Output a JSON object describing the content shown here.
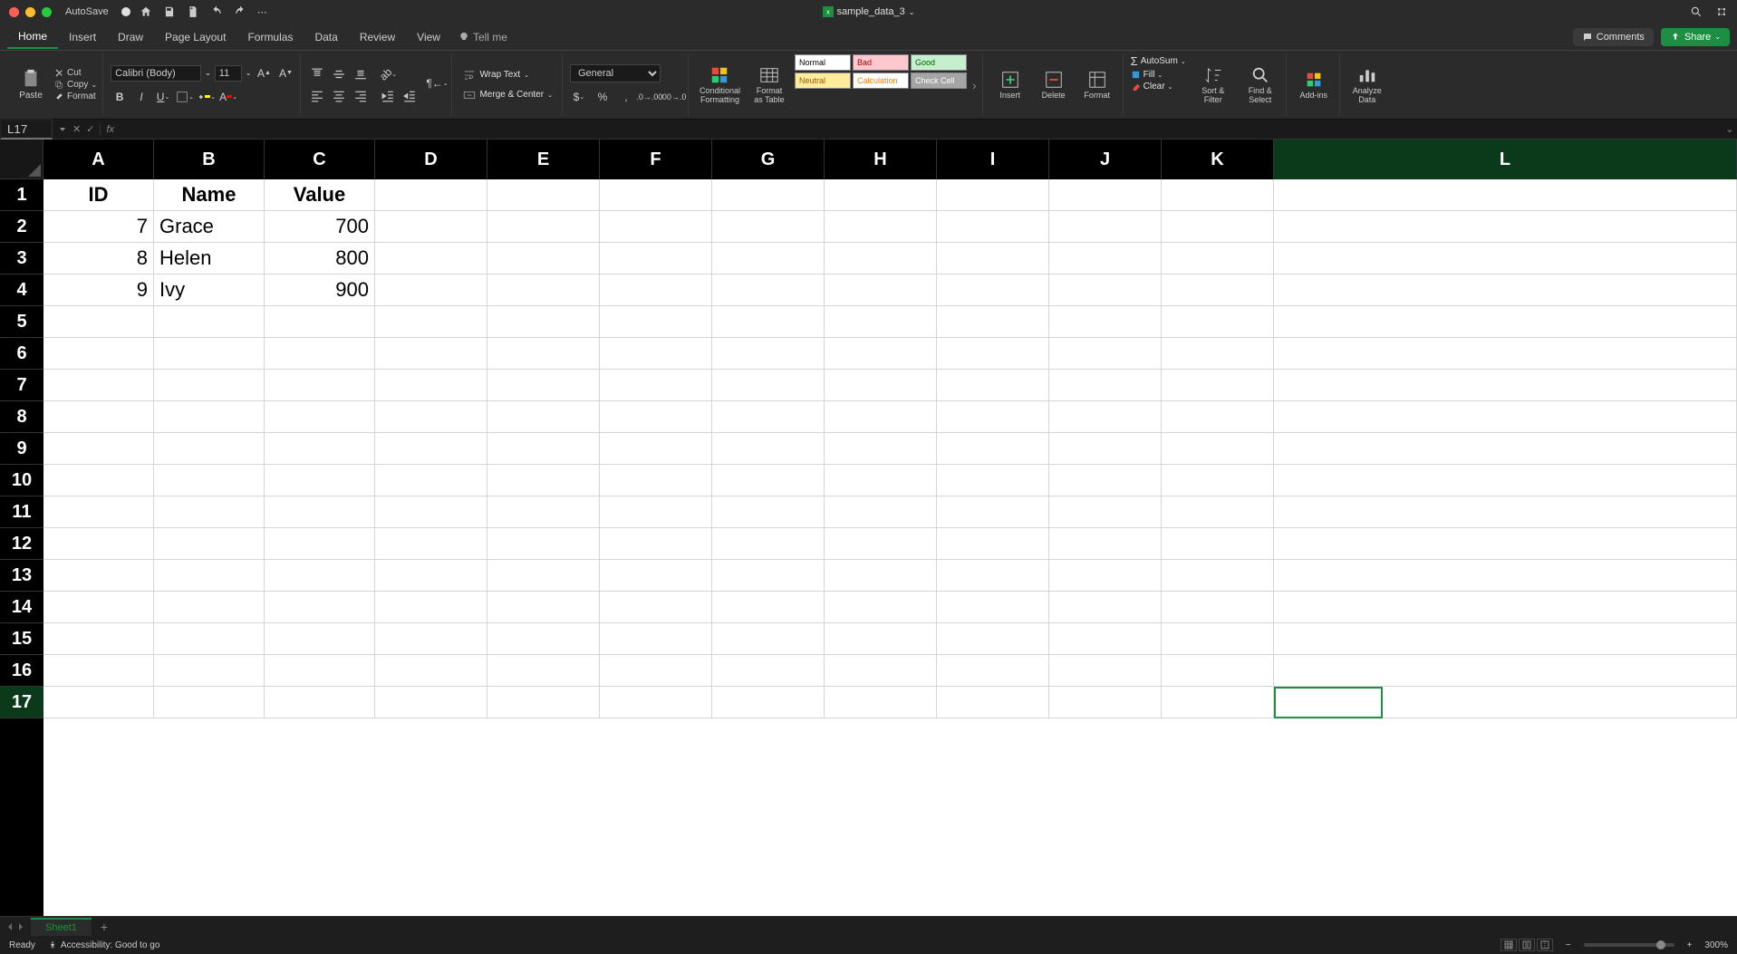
{
  "titlebar": {
    "autosave": "AutoSave",
    "filename": "sample_data_3"
  },
  "tabs": {
    "items": [
      "Home",
      "Insert",
      "Draw",
      "Page Layout",
      "Formulas",
      "Data",
      "Review",
      "View"
    ],
    "tellme": "Tell me",
    "comments": "Comments",
    "share": "Share"
  },
  "ribbon": {
    "paste": "Paste",
    "cut": "Cut",
    "copy": "Copy",
    "format": "Format",
    "font": "Calibri (Body)",
    "size": "11",
    "wrap": "Wrap Text",
    "merge": "Merge & Center",
    "numfmt": "General",
    "cond": "Conditional\nFormatting",
    "fmttable": "Format\nas Table",
    "styles": {
      "normal": "Normal",
      "bad": "Bad",
      "good": "Good",
      "neutral": "Neutral",
      "calc": "Calculation",
      "check": "Check Cell"
    },
    "insert": "Insert",
    "delete": "Delete",
    "fmt": "Format",
    "autosum": "AutoSum",
    "fill": "Fill",
    "clear": "Clear",
    "sort": "Sort &\nFilter",
    "find": "Find &\nSelect",
    "addins": "Add-ins",
    "analyze": "Analyze\nData"
  },
  "namebox": "L17",
  "columns": [
    "A",
    "B",
    "C",
    "D",
    "E",
    "F",
    "G",
    "H",
    "I",
    "J",
    "K",
    "L"
  ],
  "rows": [
    1,
    2,
    3,
    4,
    5,
    6,
    7,
    8,
    9,
    10,
    11,
    12,
    13,
    14,
    15,
    16,
    17
  ],
  "sheetdata": {
    "headers": [
      "ID",
      "Name",
      "Value"
    ],
    "rows": [
      {
        "id": "7",
        "name": "Grace",
        "value": "700"
      },
      {
        "id": "8",
        "name": "Helen",
        "value": "800"
      },
      {
        "id": "9",
        "name": "Ivy",
        "value": "900"
      }
    ]
  },
  "sheets": {
    "active": "Sheet1"
  },
  "statusbar": {
    "ready": "Ready",
    "acc": "Accessibility: Good to go",
    "zoom": "300%"
  }
}
